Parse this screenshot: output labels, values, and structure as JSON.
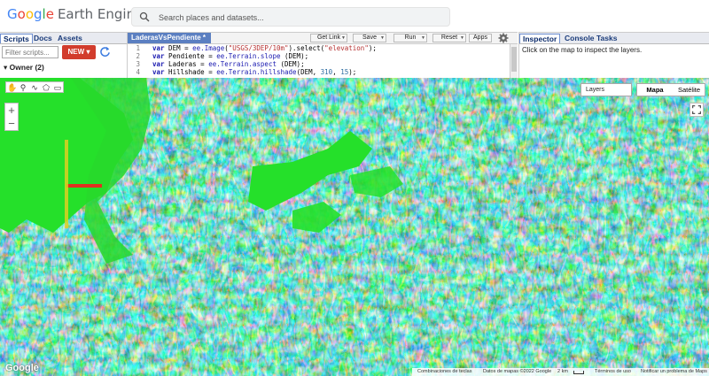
{
  "header": {
    "logo_g": "G",
    "logo_o1": "o",
    "logo_o2": "o",
    "logo_g2": "g",
    "logo_l": "l",
    "logo_e": "e",
    "logo_rest": "Earth Engine",
    "search_placeholder": "Search places and datasets..."
  },
  "left_panel": {
    "tabs": [
      "Scripts",
      "Docs",
      "Assets"
    ],
    "filter_placeholder": "Filter scripts...",
    "new_label": "NEW",
    "owner_label": "Owner (2)"
  },
  "editor": {
    "title": "LaderasVsPendiente *",
    "buttons": {
      "get_link": "Get Link",
      "save": "Save",
      "run": "Run",
      "reset": "Reset",
      "apps": "Apps"
    },
    "lines": [
      {
        "n": "1",
        "kw": "var",
        "name": " DEM = ",
        "fn": "ee.Image",
        "p1": "(",
        "str": "\"USGS/3DEP/10m\"",
        "p2": ").select(",
        "str2": "\"elevation\"",
        "p3": ");"
      },
      {
        "n": "2",
        "kw": "var",
        "name": " Pendiente = ",
        "fn": "ee.Terrain.slope",
        "rest": " (DEM);"
      },
      {
        "n": "3",
        "kw": "var",
        "name": " Laderas = ",
        "fn": "ee.Terrain.aspect",
        "rest": " (DEM);"
      },
      {
        "n": "4",
        "kw": "var",
        "name": " Hillshade = ",
        "fn": "ee.Terrain.hillshade",
        "rest": "(DEM, ",
        "num1": "310",
        "c": ", ",
        "num2": "15",
        "end": ");"
      }
    ]
  },
  "right_panel": {
    "tabs": [
      "Inspector",
      "Console",
      "Tasks"
    ],
    "message": "Click on the map to inspect the layers."
  },
  "map": {
    "layers_label": "Layers",
    "maptypes": [
      "Mapa",
      "Satélite"
    ],
    "google_logo": "Google",
    "footer": {
      "shortcuts": "Combinaciones de teclas",
      "mapdata": "Datos de mapas ©2022 Google",
      "scale": "2 km",
      "terms": "Términos de uso",
      "report": "Notificar un problema de Maps"
    }
  },
  "colors": {
    "new_button": "#d23c2c",
    "editor_tab": "#5b7fc1",
    "flat_terrain": "#25e02a"
  }
}
